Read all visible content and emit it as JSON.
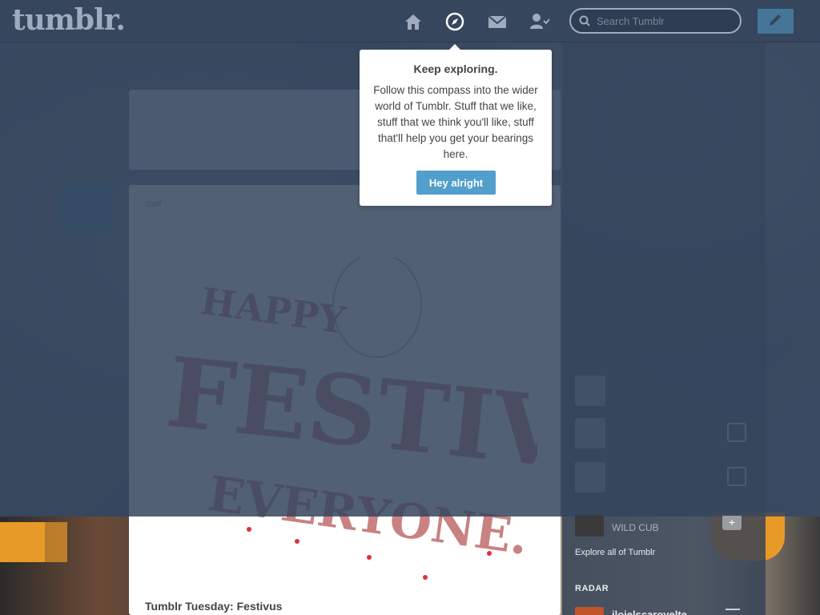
{
  "header": {
    "logo": "tumblr.",
    "search_placeholder": "Search Tumblr",
    "icons": [
      "home-icon",
      "compass-icon",
      "mail-icon",
      "account-icon",
      "compose-pencil-icon"
    ]
  },
  "popup": {
    "title": "Keep exploring.",
    "body": "Follow this compass into the wider world of Tumblr. Stuff that we like, stuff that we think you'll like, stuff that'll help you get your bearings here.",
    "button": "Hey alright"
  },
  "post": {
    "title": "Tumblr Tuesday: Festivus"
  },
  "sidebar": {
    "explore_link": "Explore all of Tumblr",
    "radar_heading": "RADAR",
    "radar_item": "ilojelscarovelte",
    "wildcub": "WILD CUB"
  },
  "colors": {
    "header_bg": "#36465d",
    "accent_blue": "#529ecc",
    "orange": "#e89a28"
  }
}
